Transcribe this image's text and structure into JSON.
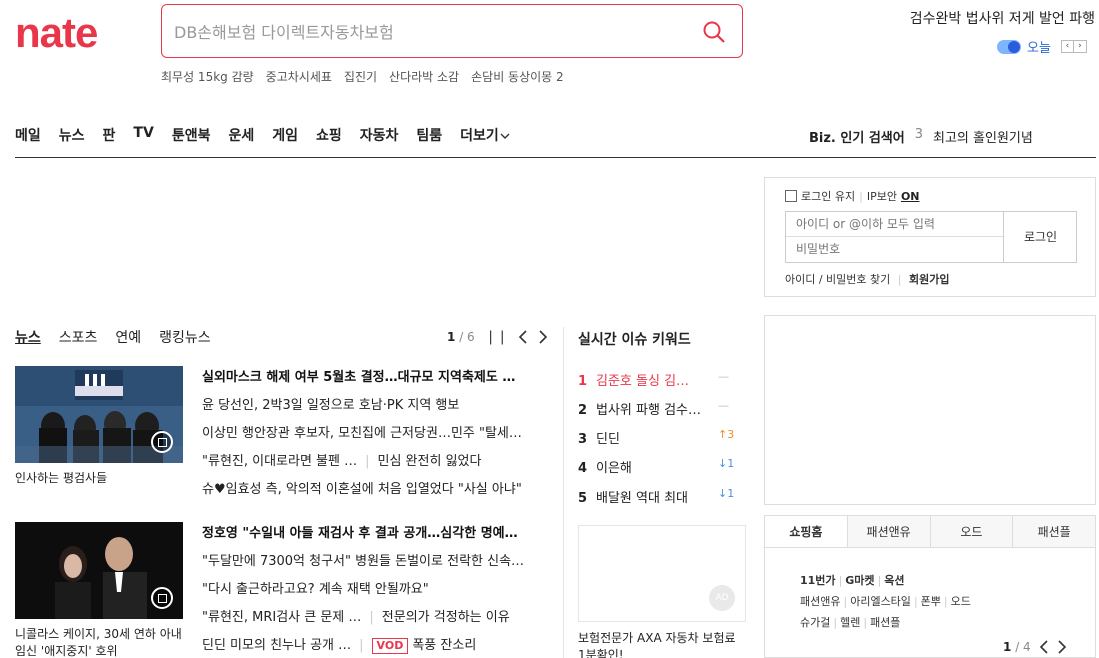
{
  "header": {
    "logo": "nate",
    "logo_color": "#e8374a",
    "search_placeholder": "DB손해보험 다이렉트자동차보험",
    "trending": [
      "최무성 15kg 감량",
      "중고차시세표",
      "집진기",
      "산다라박 소감",
      "손담비 동상이몽 2"
    ],
    "top_issue": "검수완박 법사위 저게 발언 파행",
    "today_label": "오늘"
  },
  "nav": {
    "items": [
      "메일",
      "뉴스",
      "판",
      "TV",
      "툰앤북",
      "운세",
      "게임",
      "쇼핑",
      "자동차",
      "팀룸"
    ],
    "more_label": "더보기",
    "biz_label": "Biz. 인기 검색어",
    "biz_rank": "3",
    "biz_keyword": "최고의 홀인원기념"
  },
  "login": {
    "keep_label": "로그인 유지",
    "ip_label": "IP보안",
    "ip_state": "ON",
    "id_placeholder": "아이디 or @이하 모두 입력",
    "pw_placeholder": "비밀번호",
    "login_button": "로그인",
    "find_label": "아이디 / 비밀번호 찾기",
    "join_label": "회원가입"
  },
  "news": {
    "tabs": [
      "뉴스",
      "스포츠",
      "연예",
      "랭킹뉴스"
    ],
    "page_current": "1",
    "page_total": "/ 6",
    "block1": {
      "caption": "인사하는 평검사들",
      "headline": "실외마스크 해제 여부 5월초 결정…대규모 지역축제도 …",
      "lines": [
        "윤 당선인, 2박3일 일정으로 호남·PK 지역 행보",
        "이상민 행안장관 후보자, 모친집에 근저당권…민주 \"탈세…",
        "\"류현진, 이대로라면 불펜 …",
        "슈♥임효성 측, 악의적 이혼설에 처음 입열었다 \"사실 아냐\""
      ],
      "line3_extra": "민심 완전히 잃었다"
    },
    "block2": {
      "caption": "니콜라스 케이지, 30세 연하 아내 임신 '애지중지' 호위",
      "headline": "정호영 \"수일내 아들 재검사 후 결과 공개…심각한 명예…",
      "lines": [
        "\"두달만에 7300억 청구서\" 병원들 돈벌이로 전락한 신속…",
        "\"다시 출근하라고요? 계속 재택 안될까요\"",
        "\"류현진, MRI검사 큰 문제 …",
        "딘딘 미모의 친누나 공개 …"
      ],
      "line3_extra": "전문의가 걱정하는 이유",
      "vod_label": "VOD",
      "line4_extra": "폭풍 잔소리"
    }
  },
  "keywords": {
    "title": "실시간 이슈 키워드",
    "items": [
      {
        "rank": "1",
        "text": "김준호 돌싱 김…",
        "change": "—"
      },
      {
        "rank": "2",
        "text": "법사위 파행 검수…",
        "change": "—"
      },
      {
        "rank": "3",
        "text": "딘딘",
        "change": "↑3"
      },
      {
        "rank": "4",
        "text": "이은해",
        "change": "↓1"
      },
      {
        "rank": "5",
        "text": "배달원 역대 최대",
        "change": "↓1"
      }
    ],
    "ad_badge": "AD",
    "ad_caption": "보험전문가 AXA 자동차 보험료 1분확인!"
  },
  "shopping": {
    "tabs": [
      "쇼핑홈",
      "패션앤유",
      "오드",
      "패션플"
    ],
    "row1": [
      "11번가",
      "G마켓",
      "옥션"
    ],
    "row2": [
      "패션앤유",
      "아리엘스타일",
      "폰뿌",
      "오드"
    ],
    "row3": [
      "슈가걸",
      "헬렌",
      "패션플"
    ],
    "page_current": "1",
    "page_total": "/ 4"
  },
  "colors": {
    "accent": "#e8374a",
    "blue": "#2a6bd6",
    "up": "#f08c2a",
    "down": "#4a90e2"
  }
}
